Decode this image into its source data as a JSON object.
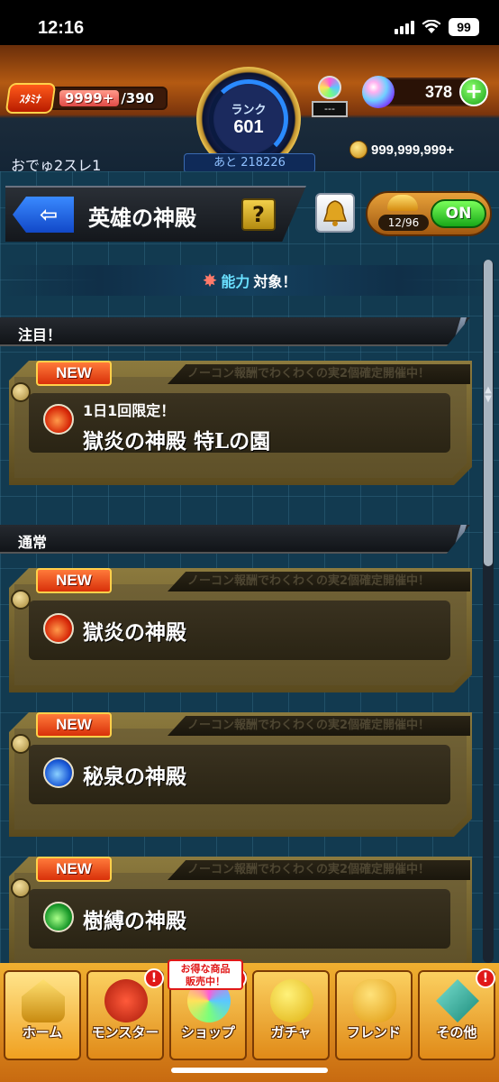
{
  "status_bar": {
    "time": "12:16",
    "battery": "99"
  },
  "header": {
    "stamina_label": "ｽﾀﾐﾅ",
    "stamina_current": "9999+",
    "stamina_max": "/390",
    "rank_label": "ランク",
    "rank_value": "601",
    "rank_next": "あと 218226",
    "gem_counter": "---",
    "orb_count": "378",
    "orb_plus": "+",
    "player_name": "おでゅ2スレ1",
    "coins": "999,999,999+"
  },
  "title_bar": {
    "back_arrow": "⇦",
    "title": "英雄の神殿",
    "help": "?",
    "toggle_count": "12/96",
    "toggle_state": "ON"
  },
  "ability_banner": {
    "highlight": "能力",
    "text": "対象！"
  },
  "sections": {
    "featured": "注目！",
    "normal": "通常"
  },
  "cards": [
    {
      "badge": "NEW",
      "tab_text": "ノーコン報酬でわくわくの実2個確定開催中！",
      "subtitle": "1日1回限定！",
      "title": "獄炎の神殿 特Lの園",
      "element": "fire"
    },
    {
      "badge": "NEW",
      "tab_text": "ノーコン報酬でわくわくの実2個確定開催中！",
      "subtitle": "",
      "title": "獄炎の神殿",
      "element": "fire"
    },
    {
      "badge": "NEW",
      "tab_text": "ノーコン報酬でわくわくの実2個確定開催中！",
      "subtitle": "",
      "title": "秘泉の神殿",
      "element": "water"
    },
    {
      "badge": "NEW",
      "tab_text": "ノーコン報酬でわくわくの実2個確定開催中！",
      "subtitle": "",
      "title": "樹縛の神殿",
      "element": "wood"
    }
  ],
  "bottom_nav": {
    "items": [
      {
        "label": "ホーム"
      },
      {
        "label": "モンスター"
      },
      {
        "label": "ショップ"
      },
      {
        "label": "ガチャ"
      },
      {
        "label": "フレンド"
      },
      {
        "label": "その他"
      }
    ],
    "sale_tag_line1": "お得な商品",
    "sale_tag_line2": "販売中！",
    "alert": "!"
  }
}
